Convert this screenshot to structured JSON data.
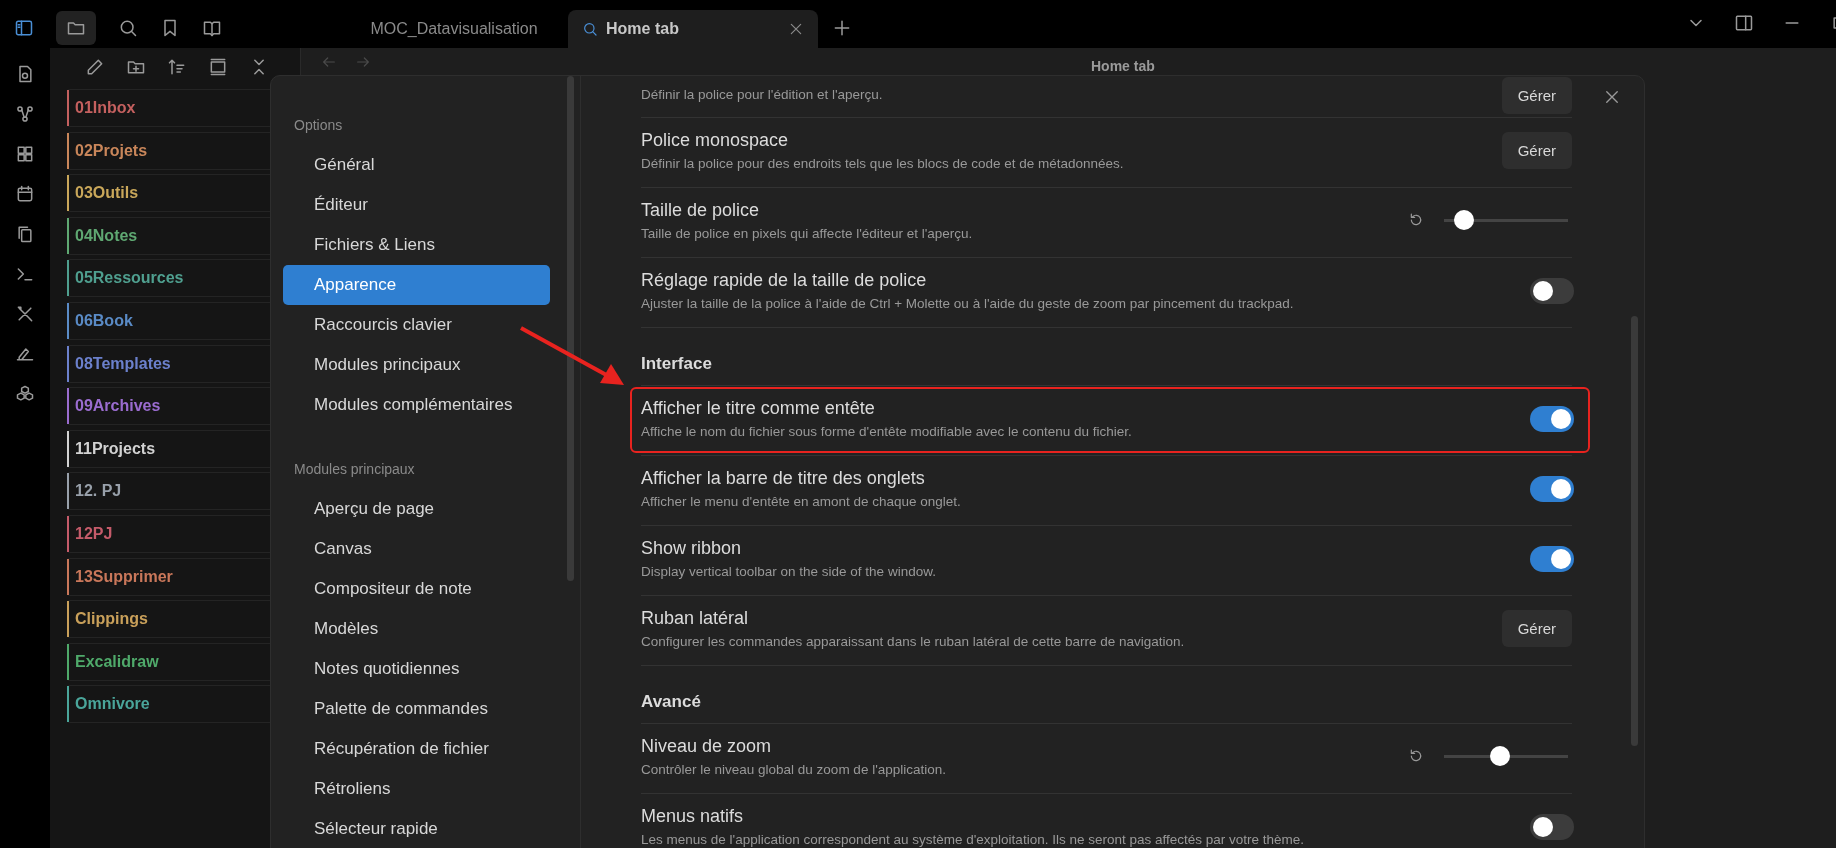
{
  "tabs": [
    {
      "label": "MOC_Datavisualisation",
      "selected": false
    },
    {
      "label": "Home tab",
      "selected": true
    }
  ],
  "main_header": {
    "title": "Home tab"
  },
  "file_explorer": {
    "folders": [
      {
        "label": "01Inbox",
        "color": "#c4605f"
      },
      {
        "label": "02Projets",
        "color": "#c9865a"
      },
      {
        "label": "03Outils",
        "color": "#c9a75a"
      },
      {
        "label": "04Notes",
        "color": "#5fa872"
      },
      {
        "label": "05Ressources",
        "color": "#4f9f8f"
      },
      {
        "label": "06Book",
        "color": "#5a8bc6"
      },
      {
        "label": "08Templates",
        "color": "#6b80cc"
      },
      {
        "label": "09Archives",
        "color": "#9a6ccf"
      },
      {
        "label": "11Projects",
        "color": "#d2d2d2"
      },
      {
        "label": "12. PJ",
        "color": "#98a0aa"
      },
      {
        "label": "12PJ",
        "color": "#c55b6a"
      },
      {
        "label": "13Supprimer",
        "color": "#c9775a"
      },
      {
        "label": "Clippings",
        "color": "#c9a05a"
      },
      {
        "label": "Excalidraw",
        "color": "#4fa96a"
      },
      {
        "label": "Omnivore",
        "color": "#4aa59a"
      }
    ]
  },
  "settings": {
    "nav": [
      {
        "heading": "Options",
        "items": [
          {
            "label": "Général",
            "selected": false
          },
          {
            "label": "Éditeur",
            "selected": false
          },
          {
            "label": "Fichiers & Liens",
            "selected": false
          },
          {
            "label": "Apparence",
            "selected": true
          },
          {
            "label": "Raccourcis clavier",
            "selected": false
          },
          {
            "label": "Modules principaux",
            "selected": false
          },
          {
            "label": "Modules complémentaires",
            "selected": false
          }
        ]
      },
      {
        "heading": "Modules principaux",
        "items": [
          {
            "label": "Aperçu de page",
            "selected": false
          },
          {
            "label": "Canvas",
            "selected": false
          },
          {
            "label": "Compositeur de note",
            "selected": false
          },
          {
            "label": "Modèles",
            "selected": false
          },
          {
            "label": "Notes quotidiennes",
            "selected": false
          },
          {
            "label": "Palette de commandes",
            "selected": false
          },
          {
            "label": "Récupération de fichier",
            "selected": false
          },
          {
            "label": "Rétroliens",
            "selected": false
          },
          {
            "label": "Sélecteur rapide",
            "selected": false
          }
        ]
      }
    ],
    "rows": [
      {
        "kind": "button",
        "description": "Définir la police pour l'édition et l'aperçu.",
        "button": "Gérer"
      },
      {
        "kind": "button",
        "title": "Police monospace",
        "description": "Définir la police pour des endroits tels que les blocs de code et de métadonnées.",
        "button": "Gérer"
      },
      {
        "kind": "slider",
        "title": "Taille de police",
        "description": "Taille de police en pixels qui affecte l'éditeur et l'aperçu.",
        "level": 0.16
      },
      {
        "kind": "toggle",
        "title": "Réglage rapide de la taille de police",
        "description": "Ajuster la taille de la police à l'aide de Ctrl + Molette ou à l'aide du geste de zoom par pincement du trackpad.",
        "on": false
      },
      {
        "kind": "heading",
        "title": "Interface"
      },
      {
        "kind": "toggle",
        "title": "Afficher le titre comme entête",
        "description": "Affiche le nom du fichier sous forme d'entête modifiable avec le contenu du fichier.",
        "on": true
      },
      {
        "kind": "toggle",
        "title": "Afficher la barre de titre des onglets",
        "description": "Afficher le menu d'entête en amont de chaque onglet.",
        "on": true
      },
      {
        "kind": "toggle",
        "title": "Show ribbon",
        "description": "Display vertical toolbar on the side of the window.",
        "on": true
      },
      {
        "kind": "button",
        "title": "Ruban latéral",
        "description": "Configurer les commandes apparaissant dans le ruban latéral de cette barre de navigation.",
        "button": "Gérer"
      },
      {
        "kind": "heading",
        "title": "Avancé"
      },
      {
        "kind": "slider",
        "title": "Niveau de zoom",
        "description": "Contrôler le niveau global du zoom de l'application.",
        "level": 0.45
      },
      {
        "kind": "toggle",
        "title": "Menus natifs",
        "description": "Les menus de l'application correspondent au système d'exploitation. Ils ne seront pas affectés par votre thème.",
        "on": false
      }
    ]
  }
}
